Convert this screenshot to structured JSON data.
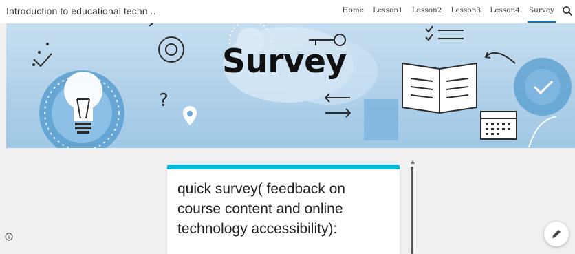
{
  "header": {
    "site_title": "Introduction to educational techn...",
    "nav": [
      {
        "label": "Home",
        "active": false
      },
      {
        "label": "Lesson1",
        "active": false
      },
      {
        "label": "Lesson2",
        "active": false
      },
      {
        "label": "Lesson3",
        "active": false
      },
      {
        "label": "Lesson4",
        "active": false
      },
      {
        "label": "Survey",
        "active": true
      }
    ],
    "search_icon": "search-icon"
  },
  "banner": {
    "title": "Survey"
  },
  "card": {
    "title": "quick survey( feedback on course content and online technology accessibility):",
    "accent_color": "#00b8d4"
  },
  "colors": {
    "active_nav_underline": "#1f6fb5",
    "banner_blue": "#b5d3ea",
    "page_background": "#f0f0f0"
  },
  "icons": {
    "info": "info-icon",
    "edit": "pencil-icon"
  }
}
